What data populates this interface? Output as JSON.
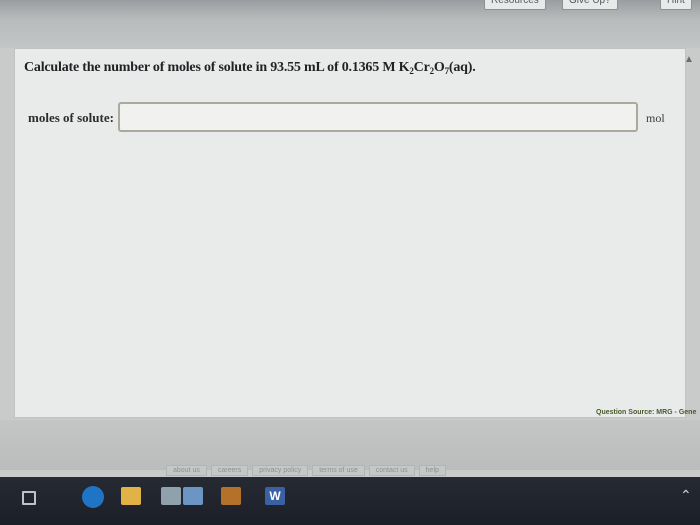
{
  "header": {
    "resources_label": "Resources",
    "give_up_label": "Give Up?",
    "hint_label": "Hint"
  },
  "question": {
    "text_prefix": "Calculate the number of moles of solute in 93.55 mL of 0.1365 M K",
    "k_sub": "2",
    "cr": "Cr",
    "cr_sub": "2",
    "o": "O",
    "o_sub": "7",
    "suffix": "(aq)."
  },
  "answer": {
    "label": "moles of solute:",
    "value": "",
    "unit": "mol"
  },
  "source": "Question Source: MRG - Gene",
  "footer": {
    "links": [
      "about us",
      "careers",
      "privacy policy",
      "terms of use",
      "contact us",
      "help"
    ]
  },
  "taskbar": {
    "word_letter": "W"
  }
}
